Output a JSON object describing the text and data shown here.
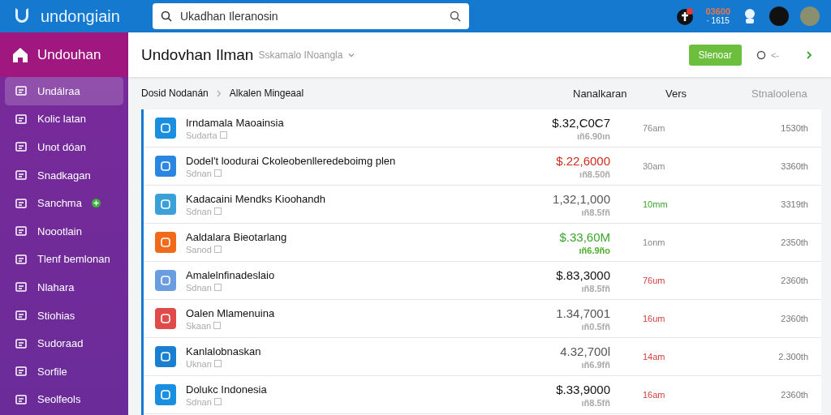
{
  "topbar": {
    "brand": "undongiain",
    "search": {
      "value": "Ukadhan Ileranosin"
    },
    "notification_count": "03600",
    "notification_sub": "· 1615"
  },
  "sidebar": {
    "title": "Undouhan",
    "items": [
      {
        "label": "Undálraa",
        "selected": true,
        "badge": false
      },
      {
        "label": "Kolic latan",
        "selected": false,
        "badge": false
      },
      {
        "label": "Unot dóan",
        "selected": false,
        "badge": false
      },
      {
        "label": "Snadkagan",
        "selected": false,
        "badge": false
      },
      {
        "label": "Sanchma",
        "selected": false,
        "badge": true
      },
      {
        "label": "Noootlain",
        "selected": false,
        "badge": false
      },
      {
        "label": "Tlenf bemlonan",
        "selected": false,
        "badge": false
      },
      {
        "label": "Nlahara",
        "selected": false,
        "badge": false
      },
      {
        "label": "Stiohias",
        "selected": false,
        "badge": false
      },
      {
        "label": "Sudoraad",
        "selected": false,
        "badge": false
      },
      {
        "label": "Sorfile",
        "selected": false,
        "badge": false
      },
      {
        "label": "Seolfeols",
        "selected": false,
        "badge": false
      }
    ]
  },
  "header": {
    "title": "Undovhan Ilman",
    "subtitle": "Sskamalo INoangla",
    "button": "Slenoar",
    "back": "<-"
  },
  "breadcrumbs": [
    "Dosid Nodanán",
    "Alkalen Mingeaal"
  ],
  "columns": [
    "Nanalkaran",
    "Vers",
    "Stnaloolena"
  ],
  "rows": [
    {
      "name": "Irndamala Maoainsia",
      "sub": "Sudarta",
      "amount": {
        "text": "$.32,C0C7",
        "color": "#111111"
      },
      "amount_sub": {
        "text": "ıñ6.90ın",
        "color": "#aaaaaa"
      },
      "time": {
        "text": "76am",
        "color": "#888888"
      },
      "value": "1530th",
      "color": "#1a8fe0"
    },
    {
      "name": "Dodel't loodurai Ckoleobenlleredeboimg plen",
      "sub": "Sdnan",
      "amount": {
        "text": "$.22,6000",
        "color": "#d0291d"
      },
      "amount_sub": {
        "text": "ıñ8.50ñ",
        "color": "#aaaaaa"
      },
      "time": {
        "text": "30am",
        "color": "#888888"
      },
      "value": "3360th",
      "color": "#2a86e0"
    },
    {
      "name": "Kadacaini Mendks Kioohandh",
      "sub": "Sdnan",
      "amount": {
        "text": "1,32,1,000",
        "color": "#555555"
      },
      "amount_sub": {
        "text": "ıñ8.5fñ",
        "color": "#aaaaaa"
      },
      "time": {
        "text": "10mm",
        "color": "#3aa52b"
      },
      "value": "3319th",
      "color": "#3aa0d8"
    },
    {
      "name": "Aaldalara Bieotarlang",
      "sub": "Sanod",
      "amount": {
        "text": "$.33,60M",
        "color": "#3aa52b"
      },
      "amount_sub": {
        "text": "ıñ6.9ño",
        "color": "#4caf2a"
      },
      "time": {
        "text": "1onm",
        "color": "#888888"
      },
      "value": "2350th",
      "color": "#f06a1a"
    },
    {
      "name": "Amalelnfinadeslaio",
      "sub": "Sdnan",
      "amount": {
        "text": "$.83,3000",
        "color": "#111111"
      },
      "amount_sub": {
        "text": "ıñ8.5fñ",
        "color": "#aaaaaa"
      },
      "time": {
        "text": "76um",
        "color": "#d24040"
      },
      "value": "2360th",
      "color": "#6a9de0"
    },
    {
      "name": "Oalen Mlamenuina",
      "sub": "Skaan",
      "amount": {
        "text": "1.34,7001",
        "color": "#555555"
      },
      "amount_sub": {
        "text": "ıñ0.5fñ",
        "color": "#aaaaaa"
      },
      "time": {
        "text": "16um",
        "color": "#d24040"
      },
      "value": "2360th",
      "color": "#e04a4a"
    },
    {
      "name": "Kanlalobnaskan",
      "sub": "Uknan",
      "amount": {
        "text": "4.32,700l",
        "color": "#555555"
      },
      "amount_sub": {
        "text": "ıñ6.9fñ",
        "color": "#aaaaaa"
      },
      "time": {
        "text": "14am",
        "color": "#d24040"
      },
      "value": "2.300th",
      "color": "#1a7fd0"
    },
    {
      "name": "Dolukc Indonesia",
      "sub": "Sdnan",
      "amount": {
        "text": "$.33,9000",
        "color": "#111111"
      },
      "amount_sub": {
        "text": "ıñ8.5fñ",
        "color": "#aaaaaa"
      },
      "time": {
        "text": "16am",
        "color": "#d24040"
      },
      "value": "2360th",
      "color": "#1a8fe0"
    }
  ]
}
